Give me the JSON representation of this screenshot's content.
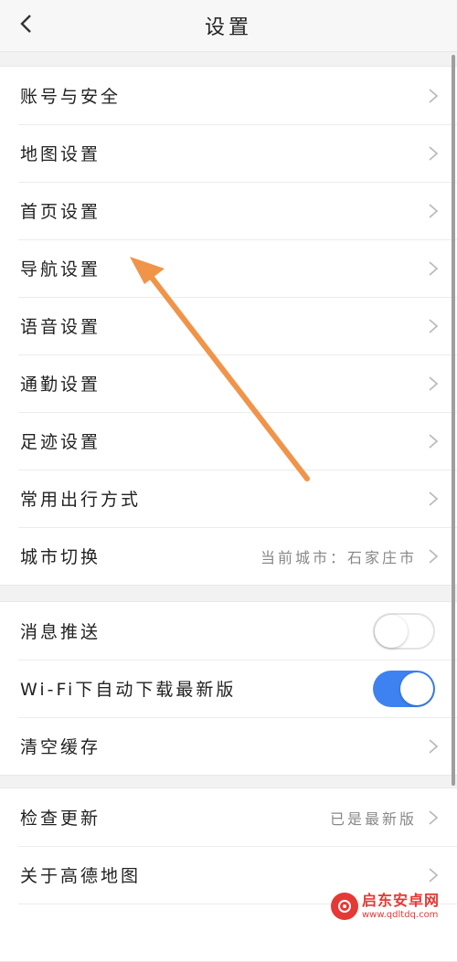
{
  "header": {
    "title": "设置",
    "back_icon": "chevron-left-icon"
  },
  "group1": {
    "items": [
      {
        "label": "账号与安全"
      },
      {
        "label": "地图设置"
      },
      {
        "label": "首页设置"
      },
      {
        "label": "导航设置"
      },
      {
        "label": "语音设置"
      },
      {
        "label": "通勤设置"
      },
      {
        "label": "足迹设置"
      },
      {
        "label": "常用出行方式"
      },
      {
        "label": "城市切换",
        "value": "当前城市：石家庄市"
      }
    ]
  },
  "group2": {
    "items": [
      {
        "label": "消息推送",
        "toggle": false
      },
      {
        "label": "Wi-Fi下自动下载最新版",
        "toggle": true
      },
      {
        "label": "清空缓存"
      }
    ]
  },
  "group3": {
    "items": [
      {
        "label": "检查更新",
        "value": "已是最新版"
      },
      {
        "label": "关于高德地图"
      }
    ]
  },
  "colors": {
    "toggle_on": "#3d82f0",
    "annotation_arrow": "#f0944a",
    "watermark": "#e53935"
  },
  "watermark": {
    "name": "启东安卓网",
    "url": "www.qdltdq.com"
  }
}
